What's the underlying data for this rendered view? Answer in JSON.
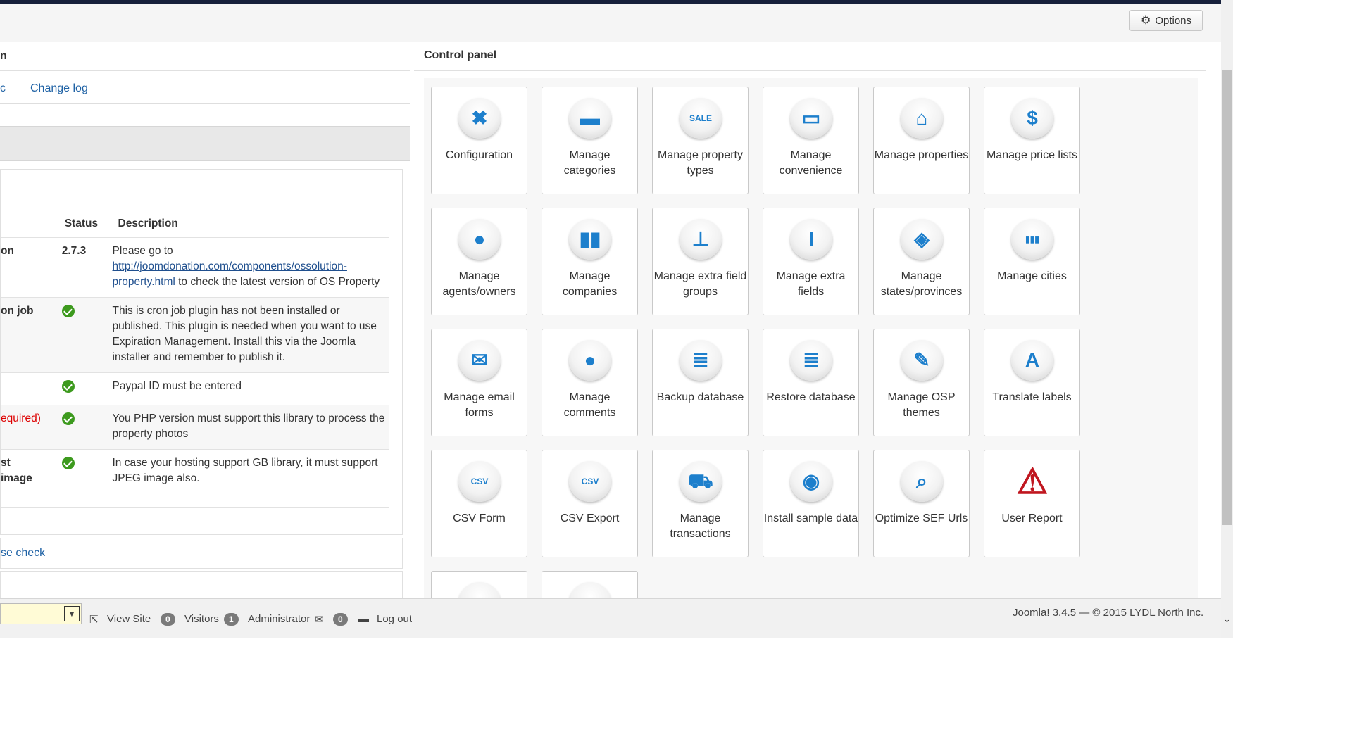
{
  "toolbar": {
    "options_label": "Options"
  },
  "left": {
    "section_title": "n",
    "links": {
      "first": "c",
      "changelog": "Change log"
    },
    "table": {
      "headers": {
        "status": "Status",
        "description": "Description"
      },
      "rows": [
        {
          "name": "on",
          "status": "2.7.3",
          "desc_pre": "Please go to ",
          "desc_link": "http://joomdonation.com/components/ossolution-property.html",
          "desc_post": " to check the latest version of OS Property"
        },
        {
          "name": "on job",
          "desc": "This is cron job plugin has not been installed or published. This plugin is needed when you want to use Expiration Management. Install this via the Joomla installer and remember to publish it."
        },
        {
          "name": "",
          "desc": "Paypal ID must be entered"
        },
        {
          "name": "equired)",
          "desc": "You PHP version must support this library to process the property photos"
        },
        {
          "name": "st",
          "name2": " image",
          "desc": "In case your hosting support GB library, it must support JPEG image also."
        }
      ]
    },
    "check_link": "se check"
  },
  "control_panel": {
    "title": "Control panel",
    "tiles": [
      {
        "label": "Configuration",
        "icon": "tools-icon",
        "glyph": "✖"
      },
      {
        "label": "Manage categories",
        "icon": "folder-icon",
        "glyph": "▬"
      },
      {
        "label": "Manage property types",
        "icon": "sale-badge-icon",
        "glyph": "SALE"
      },
      {
        "label": "Manage convenience",
        "icon": "monitor-icon",
        "glyph": "▭"
      },
      {
        "label": "Manage properties",
        "icon": "house-icon",
        "glyph": "⌂"
      },
      {
        "label": "Manage price lists",
        "icon": "house-price-icon",
        "glyph": "$"
      },
      {
        "label": "Manage agents/owners",
        "icon": "agent-icon",
        "glyph": "●"
      },
      {
        "label": "Manage companies",
        "icon": "buildings-icon",
        "glyph": "▮▮"
      },
      {
        "label": "Manage extra field groups",
        "icon": "hierarchy-icon",
        "glyph": "⊥"
      },
      {
        "label": "Manage extra fields",
        "icon": "text-field-icon",
        "glyph": "I"
      },
      {
        "label": "Manage states/provinces",
        "icon": "map-icon",
        "glyph": "◈"
      },
      {
        "label": "Manage cities",
        "icon": "city-icon",
        "glyph": "▮▮▮"
      },
      {
        "label": "Manage email forms",
        "icon": "envelope-icon",
        "glyph": "✉"
      },
      {
        "label": "Manage comments",
        "icon": "speech-bubble-icon",
        "glyph": "●"
      },
      {
        "label": "Backup database",
        "icon": "database-backup-icon",
        "glyph": "≣"
      },
      {
        "label": "Restore database",
        "icon": "database-restore-icon",
        "glyph": "≣"
      },
      {
        "label": "Manage OSP themes",
        "icon": "palette-icon",
        "glyph": "✎"
      },
      {
        "label": "Translate labels",
        "icon": "translate-icon",
        "glyph": "A"
      },
      {
        "label": "CSV Form",
        "icon": "csv-file-icon",
        "glyph": "CSV"
      },
      {
        "label": "CSV Export",
        "icon": "csv-export-icon",
        "glyph": "CSV"
      },
      {
        "label": "Manage transactions",
        "icon": "cart-icon",
        "glyph": "⛟"
      },
      {
        "label": "Install sample data",
        "icon": "install-icon",
        "glyph": "◉"
      },
      {
        "label": "Optimize SEF Urls",
        "icon": "seo-search-icon",
        "glyph": "⌕"
      },
      {
        "label": "User Report",
        "icon": "new-warning-icon",
        "glyph": "⚠"
      },
      {
        "label": "",
        "icon": "partial-tile-icon",
        "glyph": ""
      },
      {
        "label": "",
        "icon": "partial-tile-icon",
        "glyph": ""
      }
    ]
  },
  "footer": {
    "view_site": "View Site",
    "visitors_count": "0",
    "visitors_label": "Visitors",
    "admin_count": "1",
    "admin_label": "Administrator",
    "messages_count": "0",
    "logout": "Log out",
    "copyright": "Joomla! 3.4.5  —  © 2015 LYDL North Inc."
  }
}
